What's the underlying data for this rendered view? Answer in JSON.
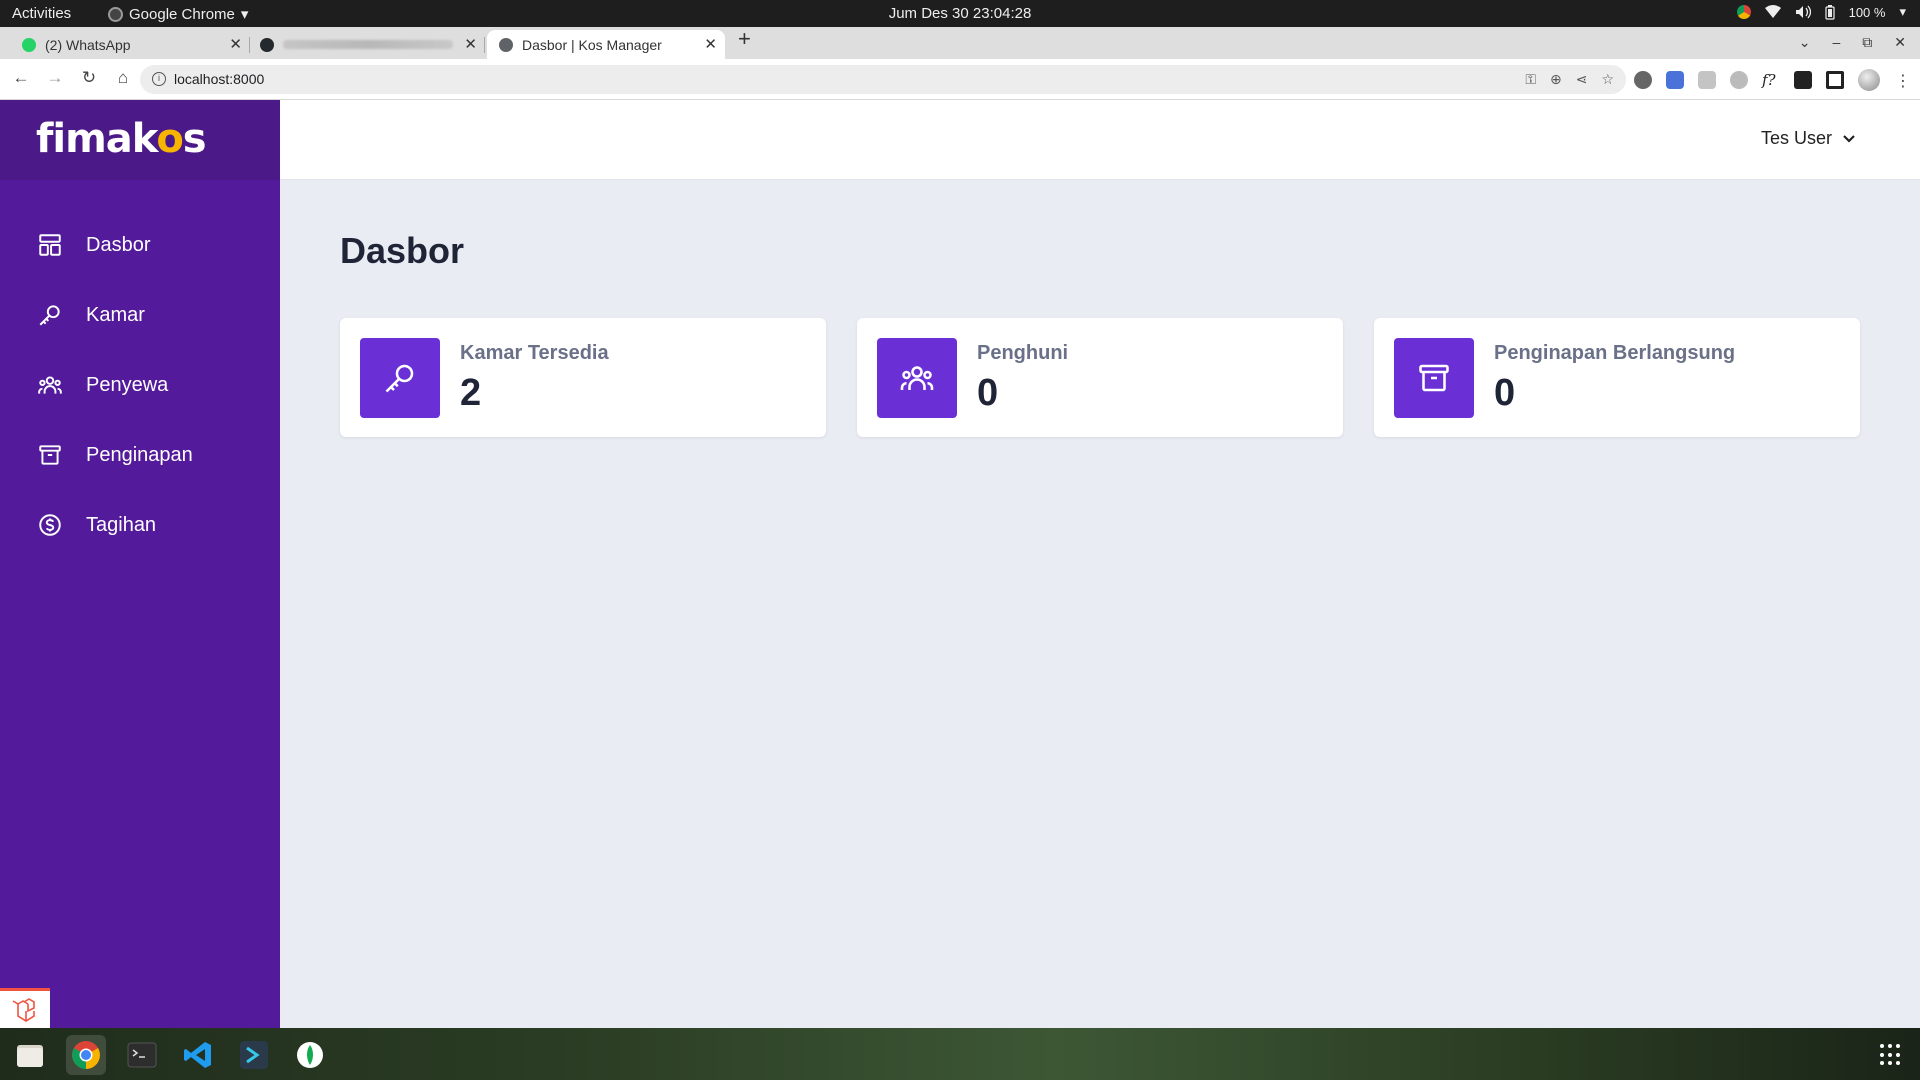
{
  "system_bar": {
    "activities": "Activities",
    "app_menu": "Google Chrome",
    "clock": "Jum Des 30  23:04:28",
    "battery": "100 %"
  },
  "browser": {
    "tabs": [
      {
        "label": "(2) WhatsApp",
        "icon": "whatsapp-icon"
      },
      {
        "label": "",
        "icon": "github-icon"
      },
      {
        "label": "Dasbor | Kos Manager",
        "icon": "globe-icon"
      }
    ],
    "url": "localhost:8000"
  },
  "app": {
    "brand": {
      "prefix": "fimak",
      "o": "o",
      "suffix": "s"
    },
    "user": "Tes User",
    "menu": [
      {
        "label": "Dasbor",
        "icon": "dashboard-icon"
      },
      {
        "label": "Kamar",
        "icon": "key-icon"
      },
      {
        "label": "Penyewa",
        "icon": "users-icon"
      },
      {
        "label": "Penginapan",
        "icon": "archive-icon"
      },
      {
        "label": "Tagihan",
        "icon": "dollar-icon"
      }
    ],
    "page_title": "Dasbor",
    "cards": [
      {
        "label": "Kamar Tersedia",
        "value": "2",
        "icon": "key-icon"
      },
      {
        "label": "Penghuni",
        "value": "0",
        "icon": "users-icon"
      },
      {
        "label": "Penginapan Berlangsung",
        "value": "0",
        "icon": "archive-icon"
      }
    ]
  },
  "colors": {
    "sidebar": "#531a9b",
    "accent": "#6a30d6",
    "background": "#e9ecf3"
  }
}
